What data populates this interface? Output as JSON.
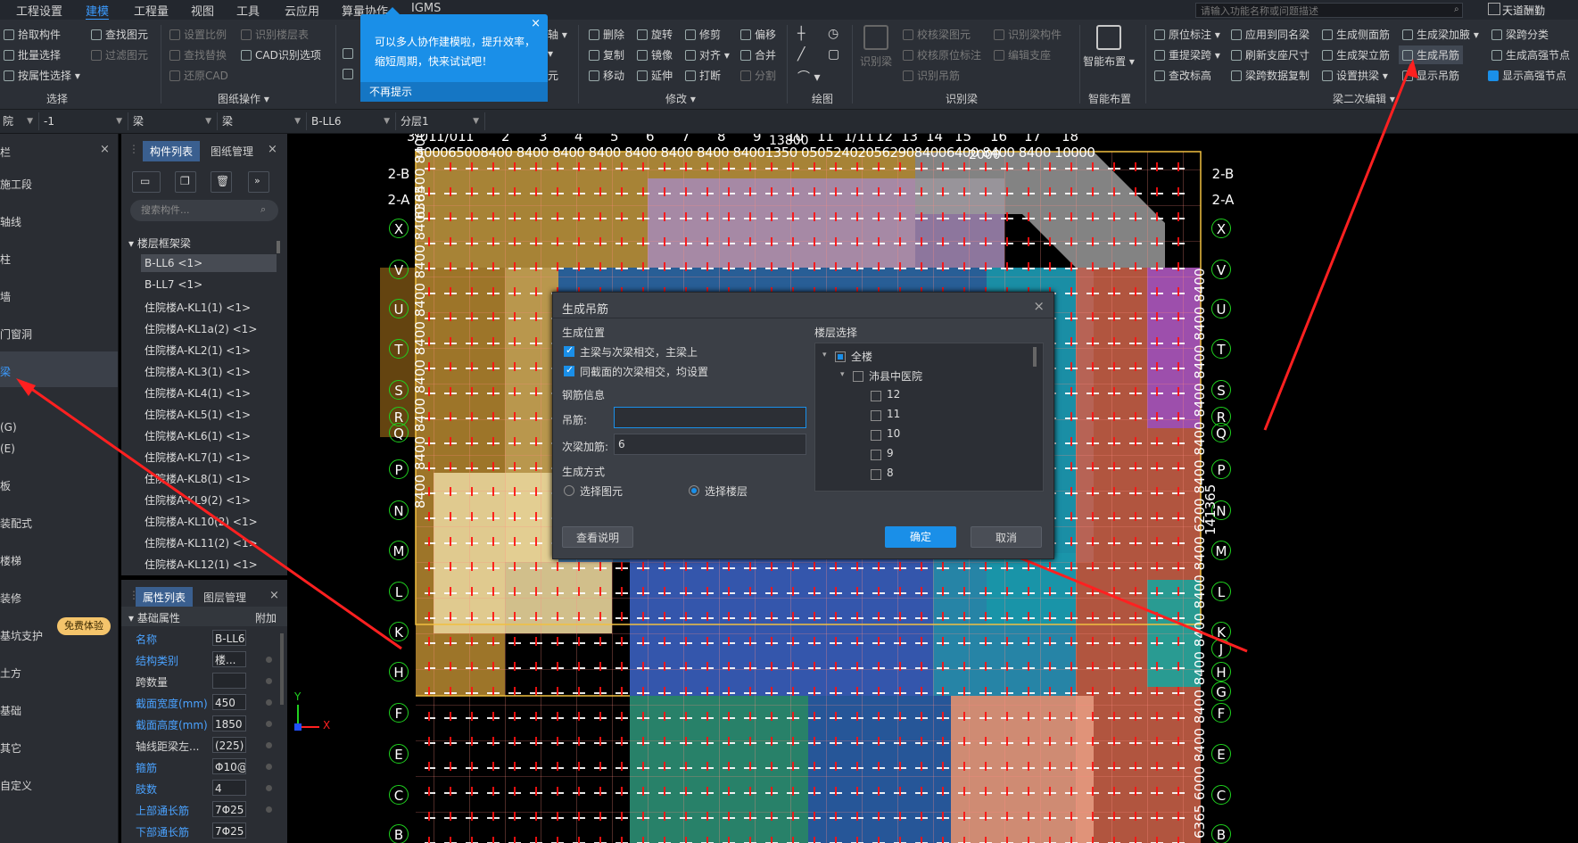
{
  "menubar": {
    "items": [
      "工程设置",
      "建模",
      "工程量",
      "视图",
      "工具",
      "云应用",
      "算量协作",
      "IGMS"
    ],
    "active_index": 1,
    "search_placeholder": "请输入功能名称或问题描述",
    "user": "天道酬勤"
  },
  "ribbon": {
    "select": {
      "pick": "拾取构件",
      "batch": "批量选择",
      "by_attr": "按属性选择",
      "find": "查找图元",
      "filter": "过滤图元",
      "group": "选择"
    },
    "drawing": {
      "scale": "设置比例",
      "find_replace": "查找替换",
      "restore_cad": "还原CAD",
      "recognize_floor": "识别楼层表",
      "cad_options": "CAD识别选项",
      "group": "图纸操作"
    },
    "edit": {
      "delete": "删除",
      "rotate": "旋转",
      "trim": "修剪",
      "offset": "偏移",
      "copy": "复制",
      "mirror": "镜像",
      "align": "对齐",
      "merge": "合并",
      "move": "移动",
      "extend": "延伸",
      "break": "打断",
      "split": "分割",
      "group": "修改",
      "axis": "轴",
      "element": "元"
    },
    "draw": {
      "group": "绘图"
    },
    "recognize_beam": {
      "big": "识别梁",
      "check_elem": "校核梁图元",
      "check_origin": "校核原位标注",
      "recognize_hanger": "识别吊筋",
      "recognize_beam_member": "识别梁构件",
      "edit_support": "编辑支座",
      "group": "识别梁"
    },
    "smart": {
      "big": "智能布置",
      "group": "智能布置"
    },
    "beam2": {
      "origin_label": "原位标注",
      "apply_same": "应用到同名梁",
      "gen_side": "生成侧面筋",
      "gen_extra": "生成梁加腋",
      "span_class": "梁跨分类",
      "re_span": "重提梁跨",
      "refresh_support": "刷新支座尺寸",
      "gen_stand": "生成架立筋",
      "gen_hanger": "生成吊筋",
      "gen_high": "生成高强节点",
      "check_height": "查改标高",
      "copy_data": "梁跨数据复制",
      "set_arch": "设置拱梁",
      "show_hanger": "显示吊筋",
      "show_high": "显示高强节点",
      "group": "梁二次编辑"
    }
  },
  "tooltip": {
    "message": "可以多人协作建模啦，提升效率，缩短周期，快来试试吧！",
    "dismiss": "不再提示",
    "close": "×"
  },
  "toolbar2": {
    "combo1": "院",
    "combo2": "-1",
    "combo3": "梁",
    "combo4": "梁",
    "combo5": "B-LL6",
    "combo6": "分层1"
  },
  "leftnav": {
    "header": "栏",
    "items": [
      "施工段",
      "轴线",
      "柱",
      "墙",
      "门窗洞",
      "梁",
      "(G)",
      "(E)",
      "板",
      "装配式",
      "楼梯",
      "装修",
      "基坑支护",
      "土方",
      "基础",
      "其它",
      "自定义"
    ],
    "selected_index": 5,
    "free_badge": "免费体验"
  },
  "comp_panel": {
    "tab_list": "构件列表",
    "tab_drawing": "图纸管理",
    "search_placeholder": "搜索构件...",
    "tree_root": "楼层框架梁",
    "items": [
      "B-LL6 <1>",
      "B-LL7 <1>",
      "住院楼A-KL1(1) <1>",
      "住院楼A-KL1a(2) <1>",
      "住院楼A-KL2(1) <1>",
      "住院楼A-KL3(1) <1>",
      "住院楼A-KL4(1) <1>",
      "住院楼A-KL5(1) <1>",
      "住院楼A-KL6(1) <1>",
      "住院楼A-KL7(1) <1>",
      "住院楼A-KL8(1) <1>",
      "住院楼A-KL9(2) <1>",
      "住院楼A-KL10(2) <1>",
      "住院楼A-KL11(2) <1>",
      "住院楼A-KL12(1) <1>"
    ],
    "selected_index": 0
  },
  "prop_panel": {
    "tab_attr": "属性列表",
    "tab_layer": "图层管理",
    "section": "基础属性",
    "extra": "附加",
    "rows": [
      {
        "label": "名称",
        "value": "B-LL6",
        "blue": true
      },
      {
        "label": "结构类别",
        "value": "楼...",
        "blue": true
      },
      {
        "label": "跨数量",
        "value": "",
        "blue": false
      },
      {
        "label": "截面宽度(mm)",
        "value": "450",
        "blue": true
      },
      {
        "label": "截面高度(mm)",
        "value": "1850",
        "blue": true
      },
      {
        "label": "轴线距梁左...",
        "value": "(225)",
        "blue": false
      },
      {
        "label": "箍筋",
        "value": "Φ10@",
        "blue": true
      },
      {
        "label": "肢数",
        "value": "4",
        "blue": true
      },
      {
        "label": "上部通长筋",
        "value": "7Φ25",
        "blue": true
      },
      {
        "label": "下部通长筋",
        "value": "7Φ25",
        "blue": true
      }
    ]
  },
  "canvas": {
    "top_axes": [
      "3/01",
      "1/01",
      "1",
      "2",
      "3",
      "4",
      "5",
      "6",
      "7",
      "8",
      "9",
      "10",
      "11",
      "1/11",
      "12",
      "13",
      "14",
      "15",
      "16",
      "17",
      "18"
    ],
    "top_dims": "500065008400 8400 8400 8400 8400 8400 8400 84001350 0505240205629084006400 8400 8400 10000",
    "top_dims2": "13800",
    "top_dims3": "2000",
    "left_axes": [
      "2-B",
      "2-A",
      "X",
      "V",
      "U",
      "T",
      "S",
      "R",
      "Q",
      "P",
      "N",
      "M",
      "L",
      "K",
      "H",
      "F",
      "E",
      "C",
      "B"
    ],
    "right_axes": [
      "2-B",
      "2-A",
      "X",
      "V",
      "U",
      "T",
      "S",
      "R",
      "Q",
      "P",
      "N",
      "M",
      "L",
      "K",
      "J",
      "H",
      "G",
      "F",
      "E",
      "C",
      "B"
    ],
    "left_dims": "8400 8400 8400 8400 8400 8400 8400 8400 8400 8400 8400 8400 8400 8400 8400 8400",
    "left_dims_top": "6365",
    "right_dims": "6365 6000 8400 8400 8400 8400 8400 8400 6200 8400 8400 8400 8400 8400 8400",
    "right_mid": "141365",
    "ucs": {
      "x": "X",
      "y": "Y"
    }
  },
  "dialog": {
    "title": "生成吊筋",
    "close": "×",
    "section_position": "生成位置",
    "opt1": "主梁与次梁相交，主梁上",
    "opt2": "同截面的次梁相交，均设置",
    "section_rebar": "钢筋信息",
    "hanger_label": "吊筋:",
    "hanger_value": "",
    "secondary_label": "次梁加筋:",
    "secondary_value": "6",
    "section_method": "生成方式",
    "radio1": "选择图元",
    "radio2": "选择楼层",
    "floor_section": "楼层选择",
    "floor_all": "全楼",
    "floor_building": "沛县中医院",
    "floors": [
      "12",
      "11",
      "10",
      "9",
      "8"
    ],
    "help": "查看说明",
    "ok": "确定",
    "cancel": "取消"
  },
  "colors": {
    "accent": "#1a8fe8",
    "menu_active": "#3b9bff",
    "annotation_arrow": "#ff2020",
    "axis_green": "#1fd21f"
  }
}
